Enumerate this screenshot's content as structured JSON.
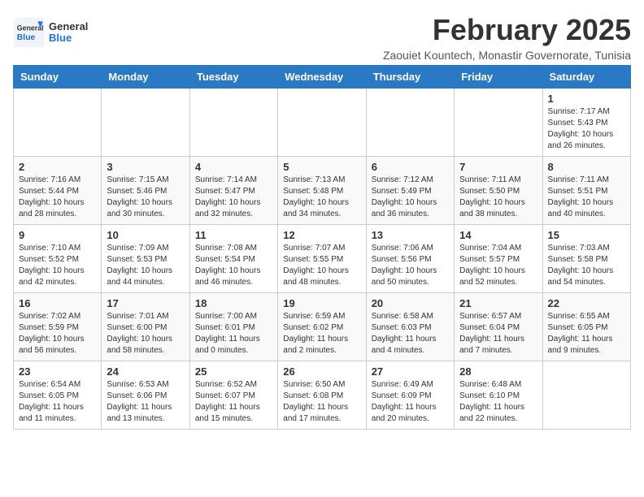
{
  "header": {
    "logo_general": "General",
    "logo_blue": "Blue",
    "month_title": "February 2025",
    "subtitle": "Zaouiet Kountech, Monastir Governorate, Tunisia"
  },
  "weekdays": [
    "Sunday",
    "Monday",
    "Tuesday",
    "Wednesday",
    "Thursday",
    "Friday",
    "Saturday"
  ],
  "weeks": [
    [
      {
        "day": "",
        "info": ""
      },
      {
        "day": "",
        "info": ""
      },
      {
        "day": "",
        "info": ""
      },
      {
        "day": "",
        "info": ""
      },
      {
        "day": "",
        "info": ""
      },
      {
        "day": "",
        "info": ""
      },
      {
        "day": "1",
        "info": "Sunrise: 7:17 AM\nSunset: 5:43 PM\nDaylight: 10 hours and 26 minutes."
      }
    ],
    [
      {
        "day": "2",
        "info": "Sunrise: 7:16 AM\nSunset: 5:44 PM\nDaylight: 10 hours and 28 minutes."
      },
      {
        "day": "3",
        "info": "Sunrise: 7:15 AM\nSunset: 5:46 PM\nDaylight: 10 hours and 30 minutes."
      },
      {
        "day": "4",
        "info": "Sunrise: 7:14 AM\nSunset: 5:47 PM\nDaylight: 10 hours and 32 minutes."
      },
      {
        "day": "5",
        "info": "Sunrise: 7:13 AM\nSunset: 5:48 PM\nDaylight: 10 hours and 34 minutes."
      },
      {
        "day": "6",
        "info": "Sunrise: 7:12 AM\nSunset: 5:49 PM\nDaylight: 10 hours and 36 minutes."
      },
      {
        "day": "7",
        "info": "Sunrise: 7:11 AM\nSunset: 5:50 PM\nDaylight: 10 hours and 38 minutes."
      },
      {
        "day": "8",
        "info": "Sunrise: 7:11 AM\nSunset: 5:51 PM\nDaylight: 10 hours and 40 minutes."
      }
    ],
    [
      {
        "day": "9",
        "info": "Sunrise: 7:10 AM\nSunset: 5:52 PM\nDaylight: 10 hours and 42 minutes."
      },
      {
        "day": "10",
        "info": "Sunrise: 7:09 AM\nSunset: 5:53 PM\nDaylight: 10 hours and 44 minutes."
      },
      {
        "day": "11",
        "info": "Sunrise: 7:08 AM\nSunset: 5:54 PM\nDaylight: 10 hours and 46 minutes."
      },
      {
        "day": "12",
        "info": "Sunrise: 7:07 AM\nSunset: 5:55 PM\nDaylight: 10 hours and 48 minutes."
      },
      {
        "day": "13",
        "info": "Sunrise: 7:06 AM\nSunset: 5:56 PM\nDaylight: 10 hours and 50 minutes."
      },
      {
        "day": "14",
        "info": "Sunrise: 7:04 AM\nSunset: 5:57 PM\nDaylight: 10 hours and 52 minutes."
      },
      {
        "day": "15",
        "info": "Sunrise: 7:03 AM\nSunset: 5:58 PM\nDaylight: 10 hours and 54 minutes."
      }
    ],
    [
      {
        "day": "16",
        "info": "Sunrise: 7:02 AM\nSunset: 5:59 PM\nDaylight: 10 hours and 56 minutes."
      },
      {
        "day": "17",
        "info": "Sunrise: 7:01 AM\nSunset: 6:00 PM\nDaylight: 10 hours and 58 minutes."
      },
      {
        "day": "18",
        "info": "Sunrise: 7:00 AM\nSunset: 6:01 PM\nDaylight: 11 hours and 0 minutes."
      },
      {
        "day": "19",
        "info": "Sunrise: 6:59 AM\nSunset: 6:02 PM\nDaylight: 11 hours and 2 minutes."
      },
      {
        "day": "20",
        "info": "Sunrise: 6:58 AM\nSunset: 6:03 PM\nDaylight: 11 hours and 4 minutes."
      },
      {
        "day": "21",
        "info": "Sunrise: 6:57 AM\nSunset: 6:04 PM\nDaylight: 11 hours and 7 minutes."
      },
      {
        "day": "22",
        "info": "Sunrise: 6:55 AM\nSunset: 6:05 PM\nDaylight: 11 hours and 9 minutes."
      }
    ],
    [
      {
        "day": "23",
        "info": "Sunrise: 6:54 AM\nSunset: 6:05 PM\nDaylight: 11 hours and 11 minutes."
      },
      {
        "day": "24",
        "info": "Sunrise: 6:53 AM\nSunset: 6:06 PM\nDaylight: 11 hours and 13 minutes."
      },
      {
        "day": "25",
        "info": "Sunrise: 6:52 AM\nSunset: 6:07 PM\nDaylight: 11 hours and 15 minutes."
      },
      {
        "day": "26",
        "info": "Sunrise: 6:50 AM\nSunset: 6:08 PM\nDaylight: 11 hours and 17 minutes."
      },
      {
        "day": "27",
        "info": "Sunrise: 6:49 AM\nSunset: 6:09 PM\nDaylight: 11 hours and 20 minutes."
      },
      {
        "day": "28",
        "info": "Sunrise: 6:48 AM\nSunset: 6:10 PM\nDaylight: 11 hours and 22 minutes."
      },
      {
        "day": "",
        "info": ""
      }
    ]
  ]
}
